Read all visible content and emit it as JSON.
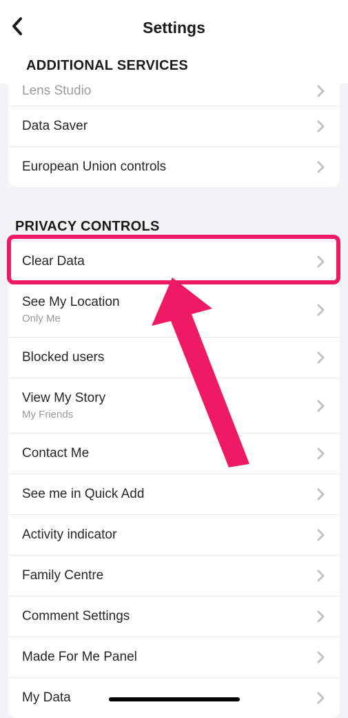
{
  "header": {
    "title": "Settings"
  },
  "sections": {
    "additional": {
      "title": "ADDITIONAL SERVICES",
      "peek_label": "Lens Studio",
      "items": [
        {
          "label": "Data Saver"
        },
        {
          "label": "European Union controls"
        }
      ]
    },
    "privacy": {
      "title": "PRIVACY CONTROLS",
      "items": [
        {
          "label": "Clear Data"
        },
        {
          "label": "See My Location",
          "sub": "Only Me"
        },
        {
          "label": "Blocked users"
        },
        {
          "label": "View My Story",
          "sub": "My Friends"
        },
        {
          "label": "Contact Me"
        },
        {
          "label": "See me in Quick Add"
        },
        {
          "label": "Activity indicator"
        },
        {
          "label": "Family Centre"
        },
        {
          "label": "Comment Settings"
        },
        {
          "label": "Made For Me Panel"
        },
        {
          "label": "My Data"
        }
      ]
    }
  },
  "annotation": {
    "highlight_target": "Clear Data",
    "arrow_color": "#ef1a63"
  }
}
